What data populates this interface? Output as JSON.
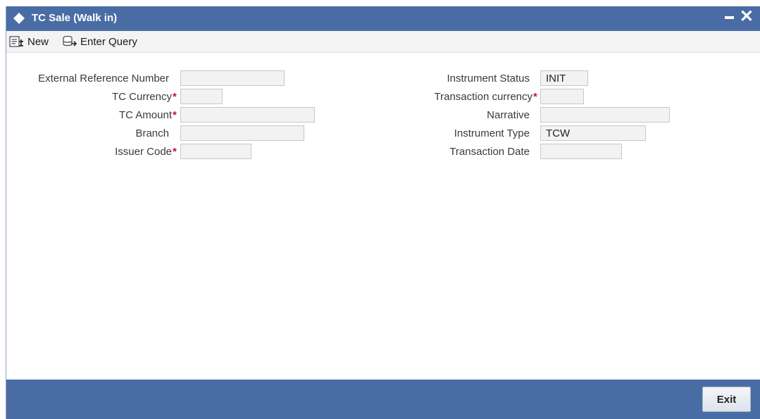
{
  "window": {
    "title": "TC Sale (Walk in)",
    "minimize_glyph": "",
    "close_glyph": "✕"
  },
  "toolbar": {
    "new_label": "New",
    "enter_query_label": "Enter Query"
  },
  "form": {
    "left": [
      {
        "label": "External Reference Number",
        "required": false,
        "value": ""
      },
      {
        "label": "TC Currency",
        "required": true,
        "value": ""
      },
      {
        "label": "TC Amount",
        "required": true,
        "value": ""
      },
      {
        "label": "Branch",
        "required": false,
        "value": ""
      },
      {
        "label": "Issuer Code",
        "required": true,
        "value": ""
      }
    ],
    "right": [
      {
        "label": "Instrument Status",
        "required": false,
        "value": "INIT"
      },
      {
        "label": "Transaction currency",
        "required": true,
        "value": ""
      },
      {
        "label": "Narrative",
        "required": false,
        "value": ""
      },
      {
        "label": "Instrument Type",
        "required": false,
        "value": "TCW"
      },
      {
        "label": "Transaction Date",
        "required": false,
        "value": ""
      }
    ],
    "required_mark": "*"
  },
  "footer": {
    "exit_label": "Exit"
  },
  "colors": {
    "titlebar": "#4a6ca5",
    "footer": "#4a6ca5",
    "required": "#c8102e"
  },
  "icons": [
    "diamond-icon",
    "minimize-icon",
    "close-icon",
    "new-document-icon",
    "enter-query-icon"
  ]
}
